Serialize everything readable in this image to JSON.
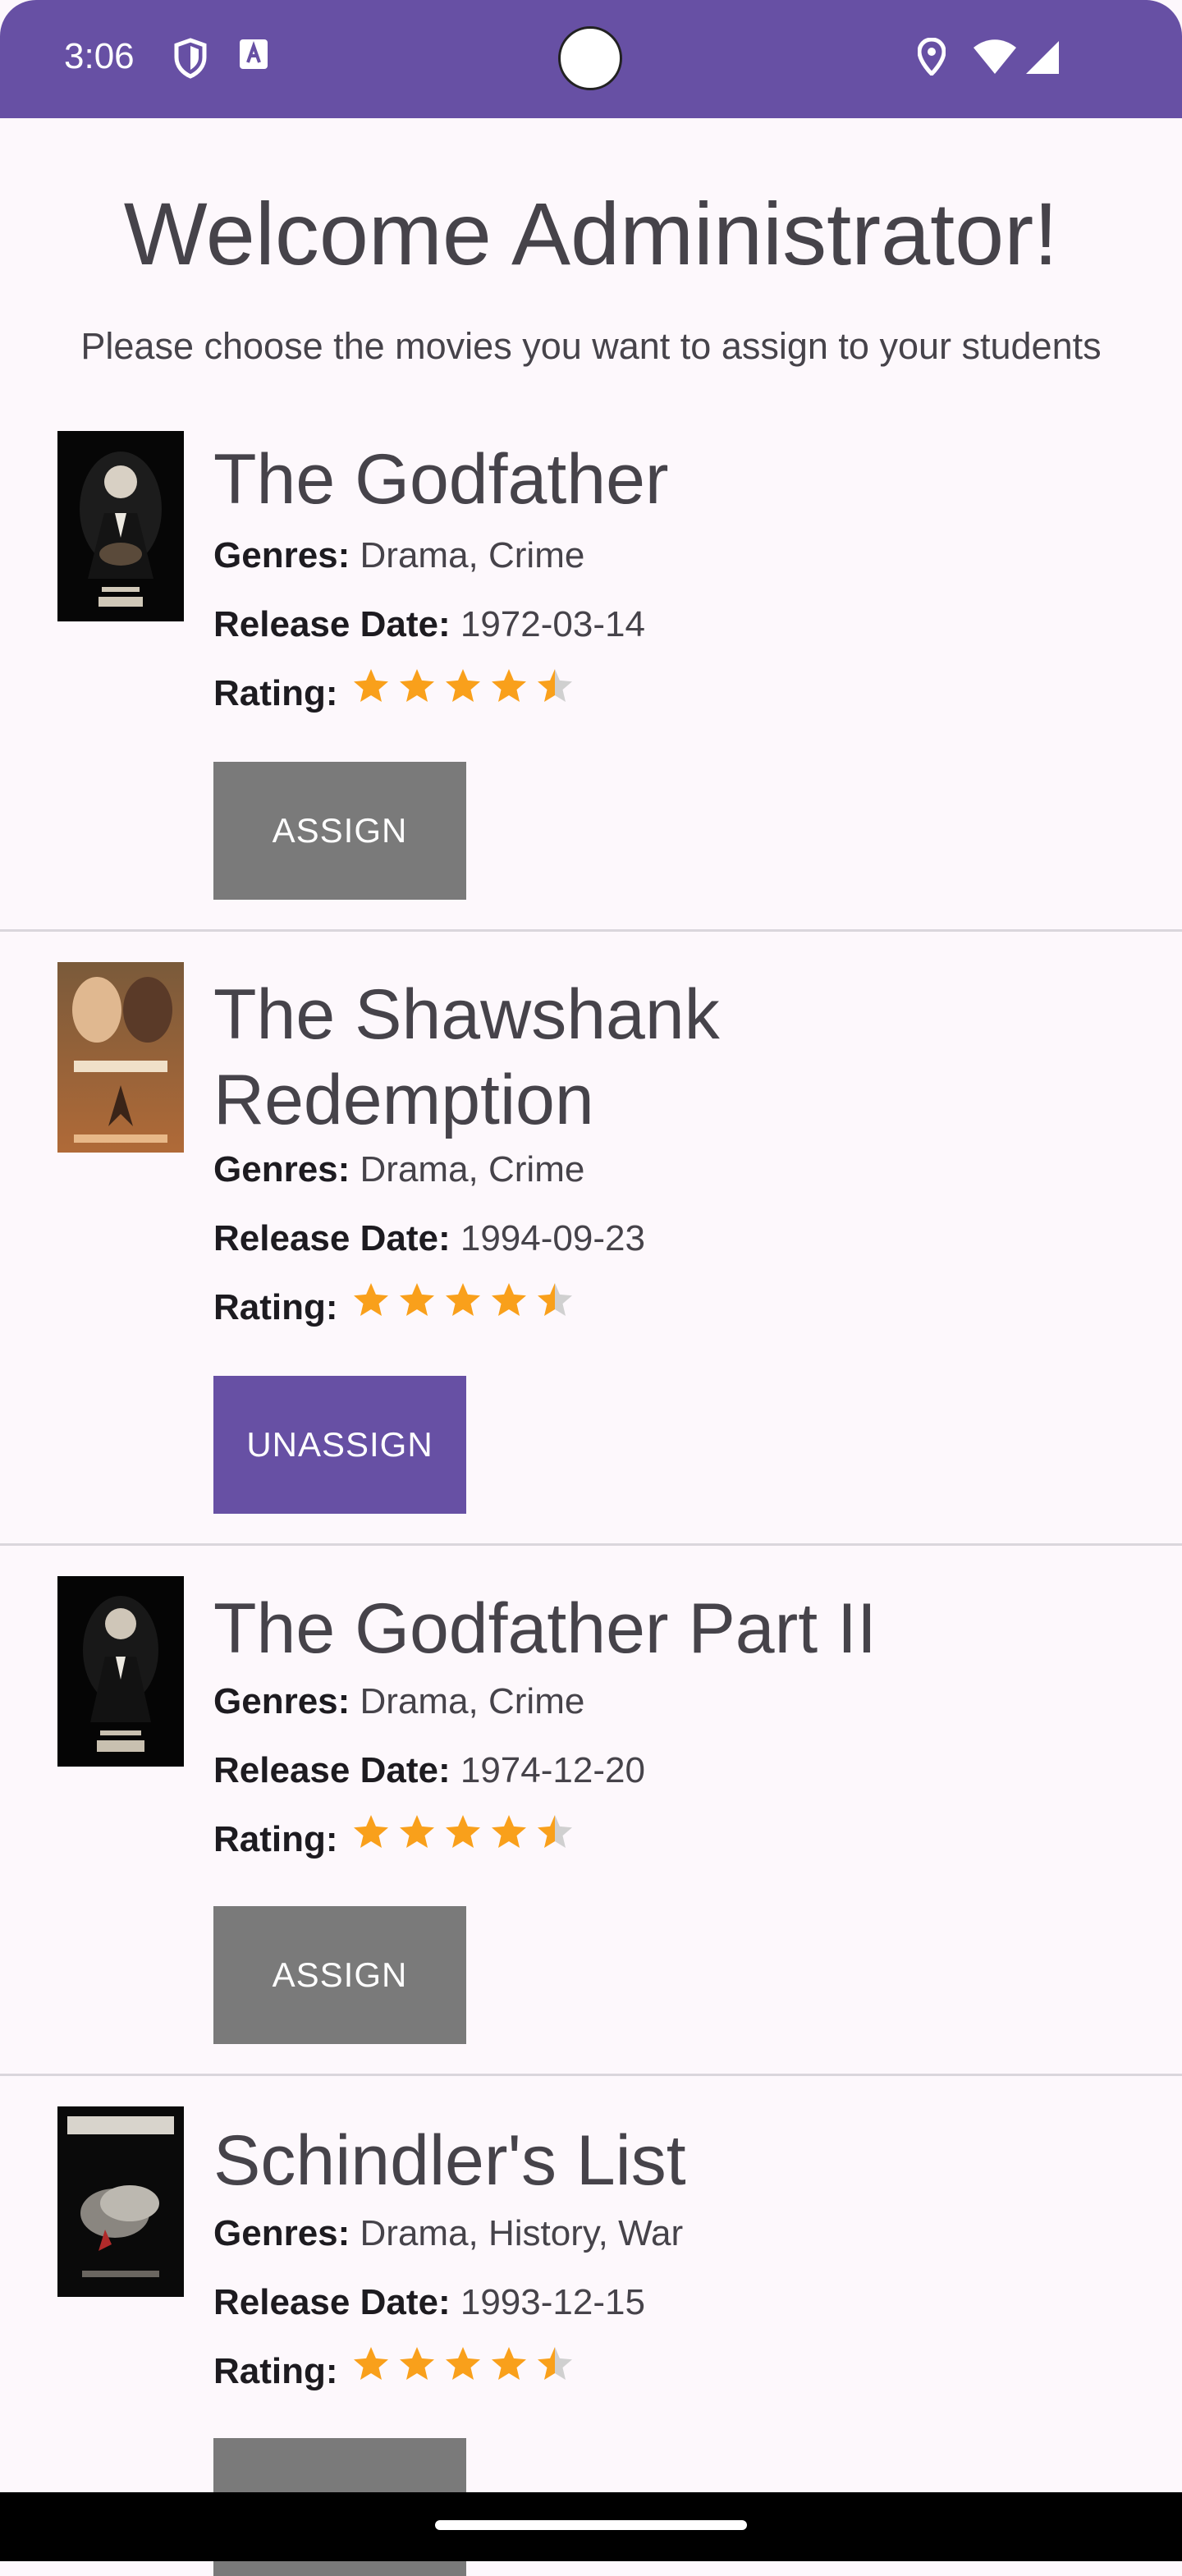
{
  "status_bar": {
    "time": "3:06"
  },
  "header": {
    "title": "Welcome Administrator!",
    "subtitle": "Please choose the movies you want to assign to your students"
  },
  "labels": {
    "genres": "Genres:",
    "release_date": "Release Date:",
    "rating": "Rating:"
  },
  "movies": [
    {
      "title": "The Godfather",
      "genres": "Drama, Crime",
      "release_date": "1972-03-14",
      "rating": 4.5,
      "button": "ASSIGN",
      "button_color": "#7a7a7a"
    },
    {
      "title": "The Shawshank Redemption",
      "genres": "Drama, Crime",
      "release_date": "1994-09-23",
      "rating": 4.5,
      "button": "UNASSIGN",
      "button_color": "#6750a4"
    },
    {
      "title": "The Godfather Part II",
      "genres": "Drama, Crime",
      "release_date": "1974-12-20",
      "rating": 4.5,
      "button": "ASSIGN",
      "button_color": "#7a7a7a"
    },
    {
      "title": "Schindler's List",
      "genres": "Drama, History, War",
      "release_date": "1993-12-15",
      "rating": 4.5,
      "button": "",
      "button_color": "#7a7a7a"
    }
  ],
  "colors": {
    "accent": "#6750a4",
    "star": "#f9a01b",
    "star_empty": "#d0d0d0"
  }
}
